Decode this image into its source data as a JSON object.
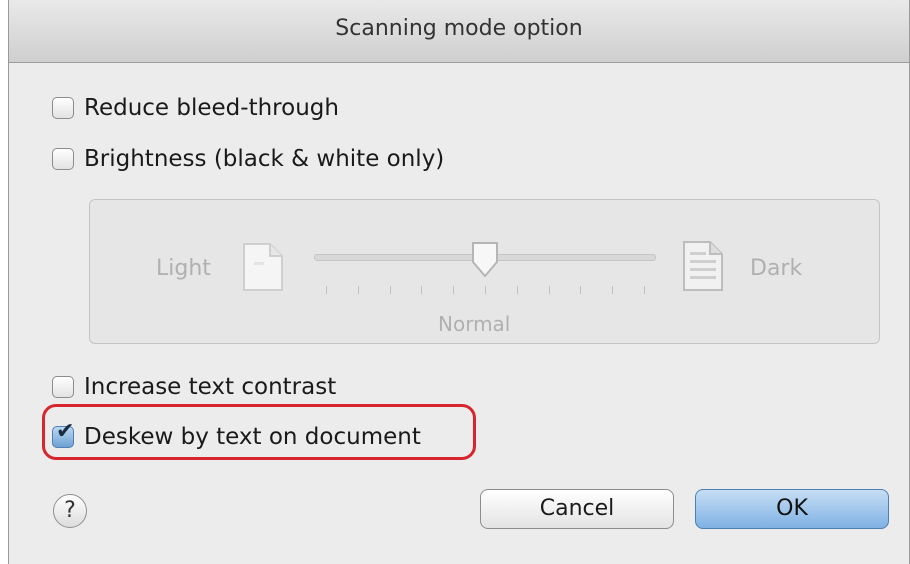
{
  "dialog": {
    "title": "Scanning mode option"
  },
  "options": {
    "reduce_bleed": {
      "label": "Reduce bleed-through",
      "checked": false
    },
    "brightness": {
      "label": "Brightness (black & white only)",
      "checked": false
    },
    "increase_contrast": {
      "label": "Increase text contrast",
      "checked": false
    },
    "deskew": {
      "label": "Deskew by text on document",
      "checked": true
    }
  },
  "brightness_panel": {
    "light_label": "Light",
    "dark_label": "Dark",
    "normal_label": "Normal",
    "enabled": false,
    "slider_fraction": 0.5
  },
  "footer": {
    "help": "?",
    "cancel_label": "Cancel",
    "ok_label": "OK"
  },
  "colors": {
    "highlight": "#d8262e",
    "default_button": "#7fb1e3"
  }
}
